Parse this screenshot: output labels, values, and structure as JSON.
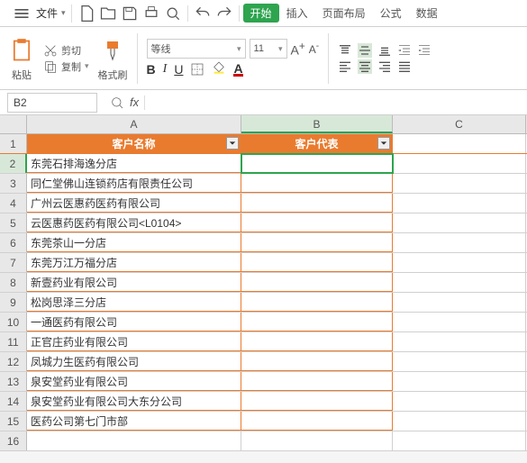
{
  "menubar": {
    "file": "文件",
    "tabs": [
      "开始",
      "插入",
      "页面布局",
      "公式",
      "数据"
    ],
    "active_tab": 0
  },
  "ribbon": {
    "cut": "剪切",
    "copy": "复制",
    "paste": "粘贴",
    "format_painter": "格式刷",
    "font_name": "等线",
    "font_size": "11",
    "format_buttons": {
      "bold": "B",
      "italic": "I",
      "underline": "U",
      "font_a_plus": "A",
      "font_a_minus": "A"
    }
  },
  "formula_bar": {
    "cell_ref": "B2",
    "fx_label": "fx",
    "value": ""
  },
  "columns": [
    "A",
    "B",
    "C"
  ],
  "headers": {
    "A": "客户名称",
    "B": "客户代表"
  },
  "rows": [
    {
      "n": 1,
      "A": "",
      "B": "",
      "isHeader": true
    },
    {
      "n": 2,
      "A": "东莞石排海逸分店",
      "B": "",
      "selected": true
    },
    {
      "n": 3,
      "A": "同仁堂佛山连锁药店有限责任公司",
      "B": ""
    },
    {
      "n": 4,
      "A": "广州云医惠药医药有限公司",
      "B": ""
    },
    {
      "n": 5,
      "A": "云医惠药医药有限公司<L0104>",
      "B": ""
    },
    {
      "n": 6,
      "A": "东莞茶山一分店",
      "B": ""
    },
    {
      "n": 7,
      "A": "东莞万江万福分店",
      "B": ""
    },
    {
      "n": 8,
      "A": "新壹药业有限公司",
      "B": ""
    },
    {
      "n": 9,
      "A": "松岗思泽三分店",
      "B": ""
    },
    {
      "n": 10,
      "A": "一通医药有限公司",
      "B": ""
    },
    {
      "n": 11,
      "A": "正官庄药业有限公司",
      "B": ""
    },
    {
      "n": 12,
      "A": "凤城力生医药有限公司",
      "B": ""
    },
    {
      "n": 13,
      "A": "泉安堂药业有限公司",
      "B": ""
    },
    {
      "n": 14,
      "A": "泉安堂药业有限公司大东分公司",
      "B": ""
    },
    {
      "n": 15,
      "A": "医药公司第七门市部",
      "B": ""
    },
    {
      "n": 16,
      "A": "",
      "B": "",
      "empty": true
    }
  ]
}
